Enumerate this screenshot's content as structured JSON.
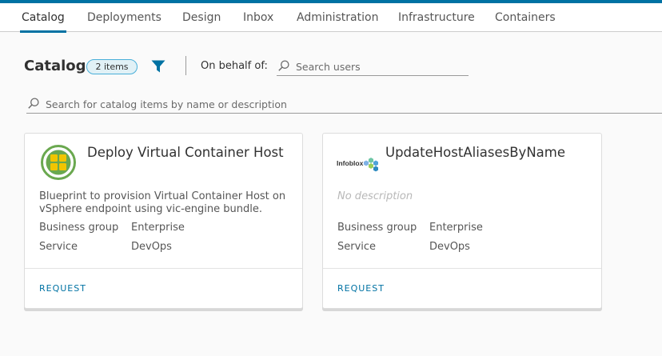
{
  "tabs": [
    "Catalog",
    "Deployments",
    "Design",
    "Inbox",
    "Administration",
    "Infrastructure",
    "Containers"
  ],
  "active_tab": "Catalog",
  "header": {
    "title": "Catalog",
    "count_badge": "2 items",
    "behalf_label": "On behalf of:",
    "users_search_placeholder": "Search users"
  },
  "catalog_search_placeholder": "Search for catalog items by name or description",
  "cards": [
    {
      "title": "Deploy Virtual Container Host",
      "icon": "vch-logo",
      "description": "Blueprint to provision Virtual Container Host on vSphere endpoint using vic-engine bundle.",
      "props": [
        {
          "label": "Business group",
          "value": "Enterprise"
        },
        {
          "label": "Service",
          "value": "DevOps"
        }
      ],
      "action": "REQUEST"
    },
    {
      "title": "UpdateHostAliasesByName",
      "icon": "infoblox-logo",
      "logo_text": "Infoblox",
      "description": "No description",
      "props": [
        {
          "label": "Business group",
          "value": "Enterprise"
        },
        {
          "label": "Service",
          "value": "DevOps"
        }
      ],
      "action": "REQUEST"
    }
  ],
  "colors": {
    "accent": "#0072a3",
    "badge_bg": "#e1f1f6",
    "badge_border": "#49afd9",
    "vch_green": "#6aa84f",
    "vch_yellow": "#f2c500"
  }
}
